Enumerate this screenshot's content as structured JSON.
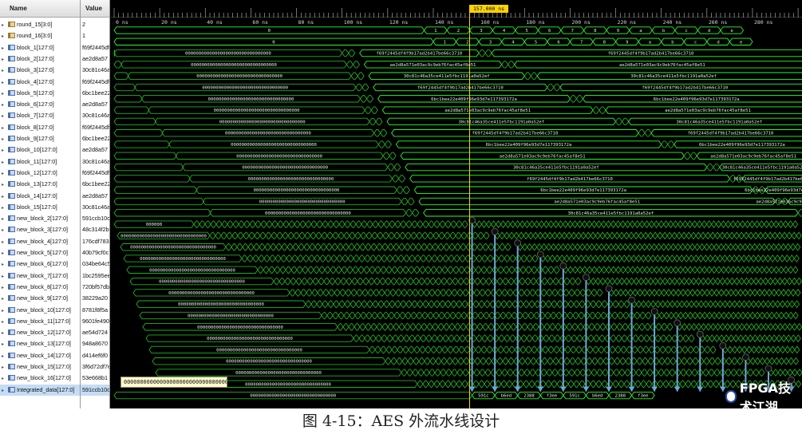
{
  "headers": {
    "name": "Name",
    "value": "Value"
  },
  "cursor": {
    "label": "157.000 ns"
  },
  "timeline": {
    "tick_labels": [
      "0 ns",
      "20 ns",
      "40 ns",
      "60 ns",
      "80 ns",
      "100 ns",
      "120 ns",
      "140 ns",
      "160 ns",
      "180 ns",
      "200 ns",
      "220 ns",
      "240 ns",
      "260 ns",
      "280 ns"
    ]
  },
  "signals": [
    {
      "name": "round_15[3:0]",
      "value": "2",
      "type": "int",
      "segs": [
        [
          "0",
          ""
        ],
        [
          "1",
          ""
        ],
        [
          "1",
          ""
        ],
        [
          "2",
          ""
        ],
        [
          "3",
          ""
        ],
        [
          "4",
          ""
        ],
        [
          "5",
          ""
        ],
        [
          "6",
          ""
        ],
        [
          "7",
          ""
        ],
        [
          "8",
          ""
        ],
        [
          "9",
          ""
        ],
        [
          "a",
          ""
        ],
        [
          "b",
          ""
        ],
        [
          "c",
          ""
        ],
        [
          "d",
          ""
        ],
        [
          "e",
          ""
        ]
      ]
    },
    {
      "name": "round_16[3:0]",
      "value": "1",
      "type": "int"
    },
    {
      "name": "block_1[127:0]",
      "value": "f69f2445df",
      "hex": "f69f2445df4f9b17ad2b417be66c3710"
    },
    {
      "name": "block_2[127:0]",
      "value": "ae2d8a57",
      "hex": "ae2d8a571e03ac9c9eb76fac45af8e51"
    },
    {
      "name": "block_3[127:0]",
      "value": "30c81c46a",
      "hex": "30c81c46a35ce411e5fbc1191a0a52ef"
    },
    {
      "name": "block_4[127:0]",
      "value": "f69f2445df",
      "hex": "f69f2445df4f9b17ad2b417be66c3710"
    },
    {
      "name": "block_5[127:0]",
      "value": "6bc1bee22",
      "hex": "6bc1bee22e409f96e93d7e117393172a"
    },
    {
      "name": "block_6[127:0]",
      "value": "ae2d8a57",
      "hex": "ae2d8a571e03ac9c9eb76fac45af8e51"
    },
    {
      "name": "block_7[127:0]",
      "value": "30c81c46a",
      "hex": "30c81c46a35ce411e5fbc1191a0a52ef"
    },
    {
      "name": "block_8[127:0]",
      "value": "f69f2445df",
      "hex": "f69f2445df4f9b17ad2b417be66c3710"
    },
    {
      "name": "block_9[127:0]",
      "value": "6bc1bee22",
      "hex": "6bc1bee22e409f96e93d7e117393172a"
    },
    {
      "name": "block_10[127:0]",
      "value": "ae2d8a57",
      "hex": "ae2d8a571e03ac9c9eb76fac45af8e51"
    },
    {
      "name": "block_11[127:0]",
      "value": "30c81c46a",
      "hex": "30c81c46a35ce411e5fbc1191a0a52ef"
    },
    {
      "name": "block_12[127:0]",
      "value": "f69f2445df",
      "hex": "f69f2445df4f9b17ad2b417be66c3710"
    },
    {
      "name": "block_13[127:0]",
      "value": "6bc1bee22",
      "hex": "6bc1bee22e409f96e93d7e117393172a"
    },
    {
      "name": "block_14[127:0]",
      "value": "ae2d8a57",
      "hex": "ae2d8a571e03ac9c9eb76fac45af8e51"
    },
    {
      "name": "block_15[127:0]",
      "value": "30c81c46a",
      "hex": "30c81c46a35ce411e5fbc1191a0a52ef"
    },
    {
      "name": "new_block_2[127:0]",
      "value": "591ccb10c"
    },
    {
      "name": "new_block_3[127:0]",
      "value": "48c314f2b"
    },
    {
      "name": "new_block_4[127:0]",
      "value": "176cdf783"
    },
    {
      "name": "new_block_5[127:0]",
      "value": "40b79cf0c"
    },
    {
      "name": "new_block_6[127:0]",
      "value": "034be64c5"
    },
    {
      "name": "new_block_7[127:0]",
      "value": "1bc2595ee"
    },
    {
      "name": "new_block_8[127:0]",
      "value": "720bf57db"
    },
    {
      "name": "new_block_9[127:0]",
      "value": "38229a20"
    },
    {
      "name": "new_block_10[127:0]",
      "value": "8781f8f5a"
    },
    {
      "name": "new_block_11[127:0]",
      "value": "9601fe490"
    },
    {
      "name": "new_block_12[127:0]",
      "value": "ae54d724"
    },
    {
      "name": "new_block_13[127:0]",
      "value": "948a8670"
    },
    {
      "name": "new_block_14[127:0]",
      "value": "d414ef6f0"
    },
    {
      "name": "new_block_15[127:0]",
      "value": "3f6d72df7e"
    },
    {
      "name": "new_block_16[127:0]",
      "value": "53e668b1"
    },
    {
      "name": "Integrated_data[127:0]",
      "value": "591ccb10c"
    }
  ],
  "round_15_values": [
    "0",
    "1",
    "2",
    "3",
    "4",
    "5",
    "6",
    "7",
    "8",
    "9",
    "a",
    "b",
    "c",
    "d",
    "e"
  ],
  "round_16_values": [
    "0",
    "1",
    "2",
    "3",
    "4",
    "5",
    "6",
    "7",
    "8",
    "9",
    "a",
    "b",
    "c",
    "d",
    "e"
  ],
  "zeros": "00000000000000000000000000000000",
  "short_zeros": "000000",
  "integrated_labels": [
    "591c",
    "b6ed",
    "2388",
    "f3ee",
    "591c",
    "b6ed",
    "2388",
    "f3ee"
  ],
  "tooltip": "000000000000000000000000000000000",
  "watermark": "FPGA技术江湖",
  "caption": "图 4-15：AES 外流水线设计",
  "colors": {
    "wave": "#26ff26",
    "zero_wave": "#1eb21e",
    "cursor": "#ffd400",
    "arrow": "#6fa6d8",
    "grid": "#3a3a3a"
  }
}
